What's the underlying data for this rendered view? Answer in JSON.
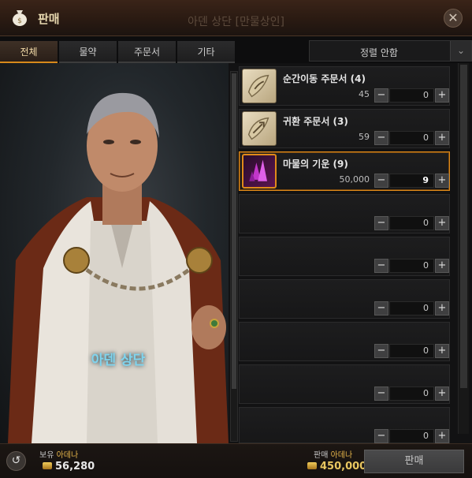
{
  "window": {
    "title": "판매",
    "subtitle": "아덴 상단 [만물상인]",
    "close_symbol": "✕"
  },
  "tabs": [
    {
      "label": "전체",
      "active": true
    },
    {
      "label": "물약",
      "active": false
    },
    {
      "label": "주문서",
      "active": false
    },
    {
      "label": "기타",
      "active": false
    }
  ],
  "sort": {
    "label": "정렬 안함",
    "arrow": "⌄"
  },
  "npc": {
    "name": "아덴 상단"
  },
  "items": [
    {
      "name": "순간이동 주문서 (4)",
      "price": "45",
      "quantity": "0",
      "icon": "teleport-scroll-icon",
      "selected": false
    },
    {
      "name": "귀환 주문서 (3)",
      "price": "59",
      "quantity": "0",
      "icon": "return-scroll-icon",
      "selected": false
    },
    {
      "name": "마물의 기운 (9)",
      "price": "50,000",
      "quantity": "9",
      "icon": "purple-crystal-icon",
      "selected": true
    },
    {
      "name": "",
      "price": "",
      "quantity": "0"
    },
    {
      "name": "",
      "price": "",
      "quantity": "0"
    },
    {
      "name": "",
      "price": "",
      "quantity": "0"
    },
    {
      "name": "",
      "price": "",
      "quantity": "0"
    },
    {
      "name": "",
      "price": "",
      "quantity": "0"
    },
    {
      "name": "",
      "price": "",
      "quantity": "0"
    }
  ],
  "stepper": {
    "minus": "−",
    "plus": "+"
  },
  "footer": {
    "own_prefix": "보유",
    "own_currency": "아데나",
    "own_amount": "56,280",
    "sell_prefix": "판매",
    "sell_currency": "아데나",
    "sell_amount": "450,000",
    "sell_button": "판매",
    "back_symbol": "↺"
  },
  "colors": {
    "accent": "#e08a1a",
    "npc_name": "#7fd4ee",
    "gold": "#e5b54a"
  }
}
